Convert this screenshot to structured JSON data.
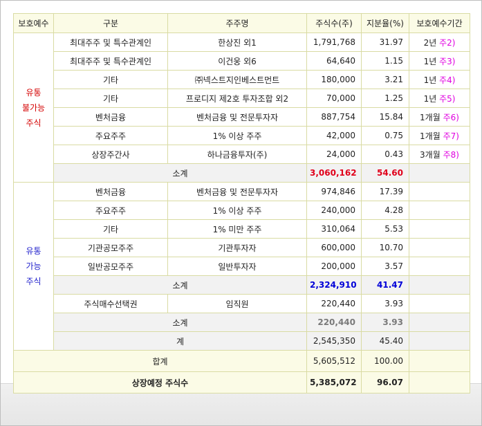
{
  "headers": [
    "보호예수",
    "구분",
    "주주명",
    "주식수(주)",
    "지분율(%)",
    "보호예수기간"
  ],
  "group1": {
    "label_lines": [
      "유통",
      "불가능",
      "주식"
    ],
    "rows": [
      {
        "category": "최대주주 및 특수관계인",
        "holder": "한상진 외1",
        "shares": "1,791,768",
        "ratio": "31.97",
        "period": "2년",
        "note": "주2)"
      },
      {
        "category": "최대주주 및 특수관계인",
        "holder": "이건웅 외6",
        "shares": "64,640",
        "ratio": "1.15",
        "period": "1년",
        "note": "주3)"
      },
      {
        "category": "기타",
        "holder": "㈜넥스트지인베스트먼트",
        "shares": "180,000",
        "ratio": "3.21",
        "period": "1년",
        "note": "주4)"
      },
      {
        "category": "기타",
        "holder": "프로디지 제2호 투자조합 외2",
        "shares": "70,000",
        "ratio": "1.25",
        "period": "1년",
        "note": "주5)"
      },
      {
        "category": "벤처금융",
        "holder": "벤처금융 및 전문투자자",
        "shares": "887,754",
        "ratio": "15.84",
        "period": "1개월",
        "note": "주6)"
      },
      {
        "category": "주요주주",
        "holder": "1% 이상 주주",
        "shares": "42,000",
        "ratio": "0.75",
        "period": "1개월",
        "note": "주7)"
      },
      {
        "category": "상장주간사",
        "holder": "하나금융투자(주)",
        "shares": "24,000",
        "ratio": "0.43",
        "period": "3개월",
        "note": "주8)"
      }
    ],
    "subtotal": {
      "label": "소계",
      "shares": "3,060,162",
      "ratio": "54.60"
    }
  },
  "group2": {
    "label_lines": [
      "유통",
      "가능",
      "주식"
    ],
    "rows": [
      {
        "category": "벤처금융",
        "holder": "벤처금융 및 전문투자자",
        "shares": "974,846",
        "ratio": "17.39"
      },
      {
        "category": "주요주주",
        "holder": "1% 이상 주주",
        "shares": "240,000",
        "ratio": "4.28"
      },
      {
        "category": "기타",
        "holder": "1% 미만 주주",
        "shares": "310,064",
        "ratio": "5.53"
      },
      {
        "category": "기관공모주주",
        "holder": "기관투자자",
        "shares": "600,000",
        "ratio": "10.70"
      },
      {
        "category": "일반공모주주",
        "holder": "일반투자자",
        "shares": "200,000",
        "ratio": "3.57"
      }
    ],
    "subtotal": {
      "label": "소계",
      "shares": "2,324,910",
      "ratio": "41.47"
    },
    "option_row": {
      "category": "주식매수선택권",
      "holder": "임직원",
      "shares": "220,440",
      "ratio": "3.93"
    },
    "option_subtotal": {
      "label": "소계",
      "shares": "220,440",
      "ratio": "3.93"
    },
    "total": {
      "label": "계",
      "shares": "2,545,350",
      "ratio": "45.40"
    }
  },
  "grand_total": {
    "label": "합계",
    "shares": "5,605,512",
    "ratio": "100.00"
  },
  "listing_planned": {
    "label": "상장예정 주식수",
    "shares": "5,385,072",
    "ratio": "96.07"
  }
}
